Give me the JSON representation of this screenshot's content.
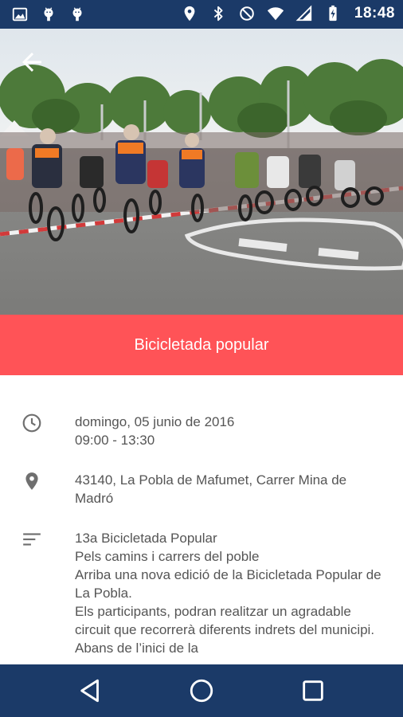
{
  "status_bar": {
    "time": "18:48",
    "left_icons": [
      "image-icon",
      "android-icon",
      "android-icon"
    ],
    "right_icons": [
      "location-icon",
      "bluetooth-icon",
      "do-not-disturb-icon",
      "wifi-icon",
      "signal-icon",
      "battery-charging-icon"
    ]
  },
  "header": {
    "back_icon": "arrow-back-icon"
  },
  "event": {
    "title": "Bicicletada popular",
    "date": "domingo, 05 junio de 2016",
    "time_range": "09:00 - 13:30",
    "address": "43140, La Pobla de Mafumet, Carrer Mina de Madró",
    "description_lines": [
      "13a Bicicletada Popular",
      "Pels camins i carrers del poble",
      "Arriba una nova edició de la Bicicletada Popular de La Pobla.",
      "Els participants, podran realitzar un agradable circuit que recorrerà diferents indrets del municipi. Abans de l’inici de la"
    ]
  },
  "colors": {
    "status_bar": "#1b3a68",
    "title_band": "#ff5357",
    "nav_bar": "#1b3a68",
    "body_text": "#555555",
    "icon_gray": "#6f6f6f"
  },
  "navigation": {
    "back": "nav-back-icon",
    "home": "nav-home-icon",
    "recents": "nav-recents-icon"
  }
}
